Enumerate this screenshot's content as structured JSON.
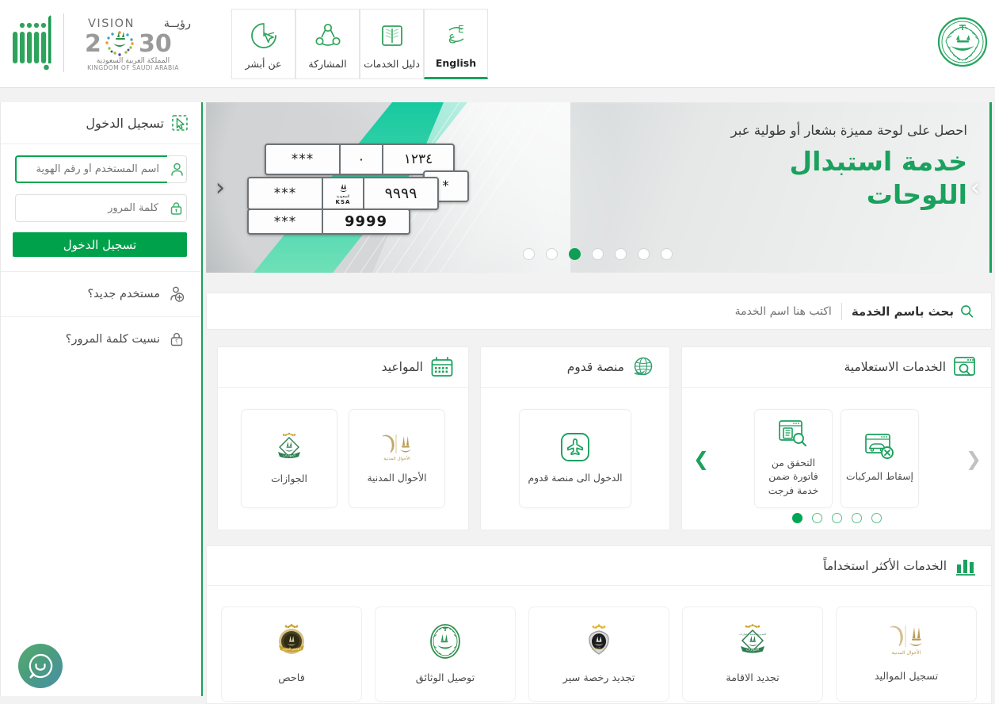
{
  "header": {
    "moi_logo_alt": "ministry-of-interior-emblem",
    "vision_logo": {
      "vision_word": "VISION",
      "vision_word_ar": "رؤية",
      "year": "2030",
      "kingdom_ar": "المملكة العربية السعودية",
      "kingdom_en": "KINGDOM OF SAUDI ARABIA"
    },
    "absher_logo_alt": "absher-wordmark",
    "nav_tabs": [
      {
        "label": "عن أبشر",
        "icon": "about-cursor-icon",
        "active": false
      },
      {
        "label": "المشاركة",
        "icon": "share-network-icon",
        "active": false
      },
      {
        "label": "دليل الخدمات",
        "icon": "book-guide-icon",
        "active": false
      },
      {
        "label": "English",
        "icon": "language-swap-icon",
        "active": true
      }
    ]
  },
  "hero": {
    "subtitle": "احصل على لوحة مميزة بشعار أو طولية عبر",
    "title_line1": "خدمة استبدال",
    "title_line2": "اللوحات",
    "plate_top": {
      "arabic_digits": "١٢٣٤",
      "dot": "٠",
      "stars": "***"
    },
    "plate_mid": {
      "arabic_digits": "٩٩٩٩",
      "country_ar": "السعودية",
      "country_en": "KSA",
      "stars": "***",
      "star_single": "*"
    },
    "plate_bot": {
      "latin_digits": "9999",
      "stars": "***"
    },
    "prev_arrow": "‹",
    "next_arrow": "›",
    "dots_total": 7,
    "dots_active_index": 4
  },
  "search": {
    "icon": "search-icon",
    "label": "بحث باسم الخدمة",
    "placeholder": "اكتب هنا اسم الخدمة",
    "value": ""
  },
  "panels": {
    "inquiry": {
      "title": "الخدمات الاستعلامية",
      "icon": "browser-search-icon",
      "prev_arrow": "❮",
      "next_arrow": "❯",
      "tiles": [
        {
          "label": "إسقاط المركبات",
          "icon": "vehicle-remove-icon"
        },
        {
          "label": "التحقق من فاتورة ضمن خدمة فرجت",
          "icon": "invoice-verify-icon"
        }
      ],
      "dots_total": 5,
      "dots_active_index": 4
    },
    "qudum": {
      "title": "منصة قدوم",
      "icon": "globe-plane-icon",
      "tiles": [
        {
          "label": "الدخول الى منصة قدوم",
          "icon": "airplane-square-icon"
        }
      ]
    },
    "appointments": {
      "title": "المواعيد",
      "icon": "calendar-icon",
      "tiles": [
        {
          "label": "الأحوال المدنية",
          "icon": "civil-affairs-emblem"
        },
        {
          "label": "الجوازات",
          "icon": "passports-emblem"
        }
      ]
    }
  },
  "most_used": {
    "title": "الخدمات الأكثر استخداماً",
    "icon": "bar-chart-icon",
    "tiles": [
      {
        "label": "تسجيل المواليد",
        "icon": "civil-affairs-emblem"
      },
      {
        "label": "تجديد الاقامة",
        "icon": "passports-emblem"
      },
      {
        "label": "تجديد رخصة سير",
        "icon": "traffic-emblem"
      },
      {
        "label": "توصيل الوثائق",
        "icon": "moi-emblem"
      },
      {
        "label": "فاحص",
        "icon": "fahes-emblem"
      }
    ]
  },
  "login": {
    "title": "تسجيل الدخول",
    "title_icon": "cursor-select-icon",
    "username": {
      "icon": "user-icon",
      "placeholder": "اسم المستخدم أو رقم الهوية",
      "value": "",
      "focused": true
    },
    "password": {
      "icon": "lock-icon",
      "placeholder": "كلمة المرور",
      "value": "",
      "focused": false
    },
    "submit_label": "تسجيل الدخول",
    "links": [
      {
        "label": "مستخدم جديد؟",
        "icon": "user-add-icon"
      },
      {
        "label": "نسيت كلمة المرور؟",
        "icon": "lock-question-icon"
      }
    ]
  },
  "chat": {
    "icon": "chat-smiley-icon",
    "tooltip": ""
  },
  "colors": {
    "brand_green": "#00a651",
    "button_green": "#00a14b",
    "accent_teal": "#2fd0a0",
    "text_dark": "#3d3d3d",
    "gold": "#b99a54"
  }
}
